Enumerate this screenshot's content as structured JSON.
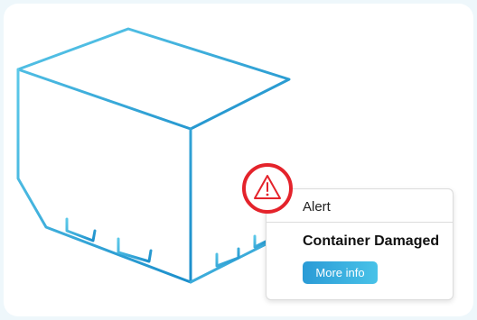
{
  "colors": {
    "page_background": "#eef7fb",
    "container_stroke_start": "#55c8e8",
    "container_stroke_end": "#1f8fcc",
    "alert_ring": "#e4232b",
    "button_start": "#2a9bd6",
    "button_end": "#48c2e8"
  },
  "illustration": {
    "icon": "shipping-container-outline"
  },
  "alert": {
    "icon": "warning-triangle-icon",
    "header": "Alert",
    "title": "Container Damaged",
    "button_label": "More info"
  }
}
